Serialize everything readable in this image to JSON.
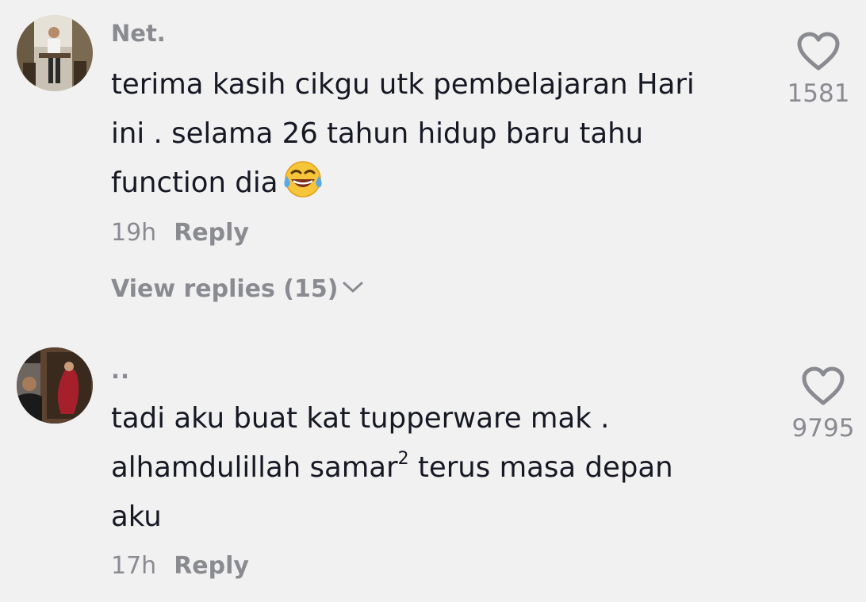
{
  "comments": [
    {
      "username": "Net.",
      "lines": [
        "terima kasih cikgu utk pembelajaran Hari",
        "ini . selama 26 tahun hidup baru tahu",
        "function dia"
      ],
      "emoji": "face-with-tears-of-joy",
      "time": "19h",
      "reply_label": "Reply",
      "view_replies_label": "View replies (15)",
      "like_icon": "heart-outline-icon",
      "like_count": "1581"
    },
    {
      "username": "..",
      "lines": [
        "tadi aku buat kat tupperware mak .",
        "alhamdulillah samar",
        "terus masa depan",
        "aku"
      ],
      "superscript": "2",
      "time": "17h",
      "reply_label": "Reply",
      "like_icon": "heart-outline-icon",
      "like_count": "9795"
    }
  ],
  "colors": {
    "background": "#f1f1f2",
    "text_primary": "#161823",
    "text_secondary": "#8a8b91"
  }
}
